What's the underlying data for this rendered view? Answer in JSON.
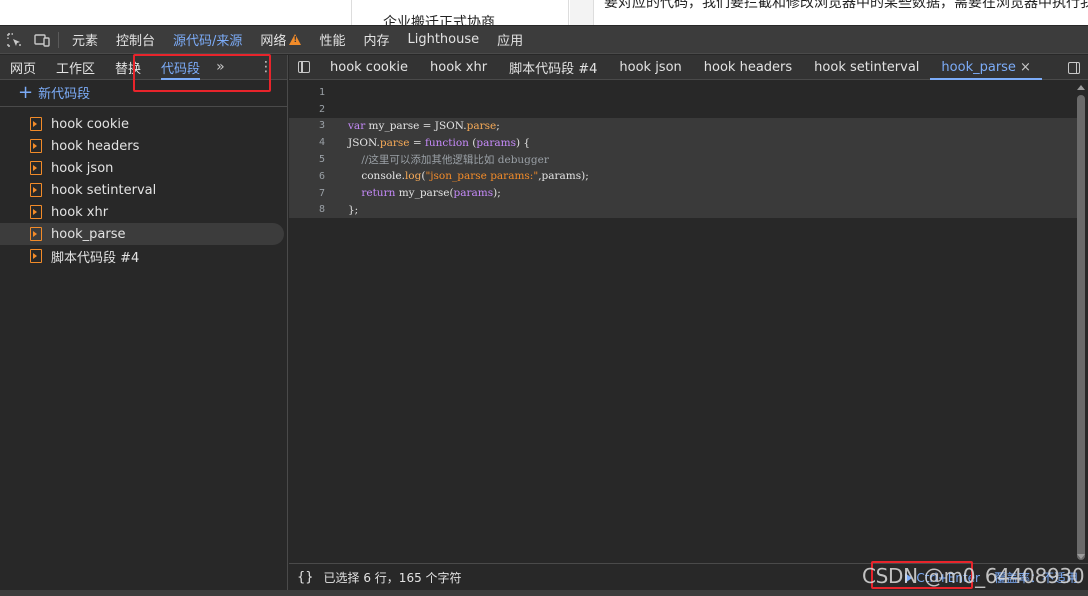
{
  "page_behind": {
    "mid_text": "企业搬迁正式协商",
    "right_text": "要对应的代码，我们要拦截和修改浏览器中的某些数据，需要在浏览器中执行我们的代码。"
  },
  "main_toolbar": {
    "tabs": [
      {
        "label": "元素",
        "active": false
      },
      {
        "label": "控制台",
        "active": false
      },
      {
        "label": "源代码/来源",
        "active": true
      },
      {
        "label": "网络",
        "active": false,
        "warning": true
      },
      {
        "label": "性能",
        "active": false
      },
      {
        "label": "内存",
        "active": false
      },
      {
        "label": "Lighthouse",
        "active": false
      },
      {
        "label": "应用",
        "active": false
      }
    ]
  },
  "navigator": {
    "tabs": [
      {
        "label": "网页",
        "active": false
      },
      {
        "label": "工作区",
        "active": false
      },
      {
        "label": "替换",
        "active": false
      },
      {
        "label": "代码段",
        "active": true
      }
    ],
    "more": "»",
    "kebab": "⋮",
    "new_snippet_label": "新代码段",
    "files": [
      {
        "label": "hook cookie",
        "selected": false
      },
      {
        "label": "hook headers",
        "selected": false
      },
      {
        "label": "hook json",
        "selected": false
      },
      {
        "label": "hook setinterval",
        "selected": false
      },
      {
        "label": "hook xhr",
        "selected": false
      },
      {
        "label": "hook_parse",
        "selected": true
      },
      {
        "label": "脚本代码段 #4",
        "selected": false
      }
    ]
  },
  "editor_tabs": {
    "tabs": [
      {
        "label": "hook cookie",
        "active": false
      },
      {
        "label": "hook xhr",
        "active": false
      },
      {
        "label": "脚本代码段 #4",
        "active": false
      },
      {
        "label": "hook json",
        "active": false
      },
      {
        "label": "hook headers",
        "active": false
      },
      {
        "label": "hook setinterval",
        "active": false
      },
      {
        "label": "hook_parse",
        "active": true,
        "close": "×"
      }
    ]
  },
  "code": {
    "line_numbers": [
      "1",
      "2",
      "3",
      "4",
      "5",
      "6",
      "7",
      "8"
    ],
    "lines": [
      "",
      "",
      "var my_parse = JSON.parse;",
      "JSON.parse = function (params) {",
      "    //这里可以添加其他逻辑比如 debugger",
      "    console.log(\"json_parse params:\",params);",
      "    return my_parse(params);",
      "};"
    ]
  },
  "statusbar": {
    "braces": "{}",
    "selection_text": "已选择 6 行，165 个字符",
    "run_label": "Ctrl+Enter",
    "coverage_label": "覆盖率：不适用"
  },
  "watermark": "CSDN @m0_64408930",
  "colors": {
    "accent": "#7cacf8",
    "warning": "#f28b29",
    "annotation_red": "#e8242b",
    "background": "#282828"
  }
}
